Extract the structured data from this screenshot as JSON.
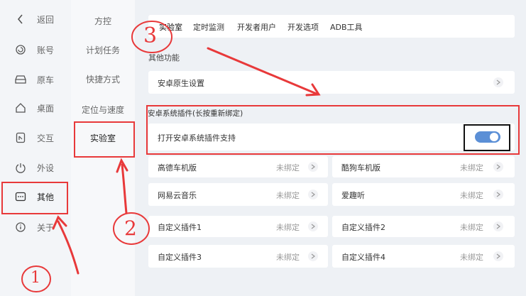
{
  "nav": {
    "items": [
      {
        "label": "返回",
        "icon": "chevron-left-icon"
      },
      {
        "label": "账号",
        "icon": "account-icon"
      },
      {
        "label": "原车",
        "icon": "car-icon"
      },
      {
        "label": "桌面",
        "icon": "home-icon"
      },
      {
        "label": "交互",
        "icon": "interaction-icon"
      },
      {
        "label": "外设",
        "icon": "power-icon"
      },
      {
        "label": "其他",
        "icon": "more-icon"
      },
      {
        "label": "关于",
        "icon": "info-icon"
      }
    ]
  },
  "subnav": {
    "items": [
      "方控",
      "计划任务",
      "快捷方式",
      "定位与速度",
      "实验室"
    ]
  },
  "tabs": [
    "实验室",
    "定时监测",
    "开发者用户",
    "开发选项",
    "ADB工具"
  ],
  "main": {
    "section_title": "其他功能",
    "android_settings_label": "安卓原生设置",
    "plugin_section_title": "安卓系统插件(长按重新绑定)",
    "plugin_toggle_label": "打开安卓系统插件支持",
    "plugins": [
      {
        "name": "高德车机版",
        "status": "未绑定"
      },
      {
        "name": "酷狗车机版",
        "status": "未绑定"
      },
      {
        "name": "网易云音乐",
        "status": "未绑定"
      },
      {
        "name": "爱趣听",
        "status": "未绑定"
      },
      {
        "name": "自定义插件1",
        "status": "未绑定"
      },
      {
        "name": "自定义插件2",
        "status": "未绑定"
      },
      {
        "name": "自定义插件3",
        "status": "未绑定"
      },
      {
        "name": "自定义插件4",
        "status": "未绑定"
      }
    ]
  },
  "annotations": {
    "num1": "1",
    "num2": "2",
    "num3": "3"
  },
  "colors": {
    "accent": "#5b8fd6",
    "annotation": "#e8393a"
  }
}
